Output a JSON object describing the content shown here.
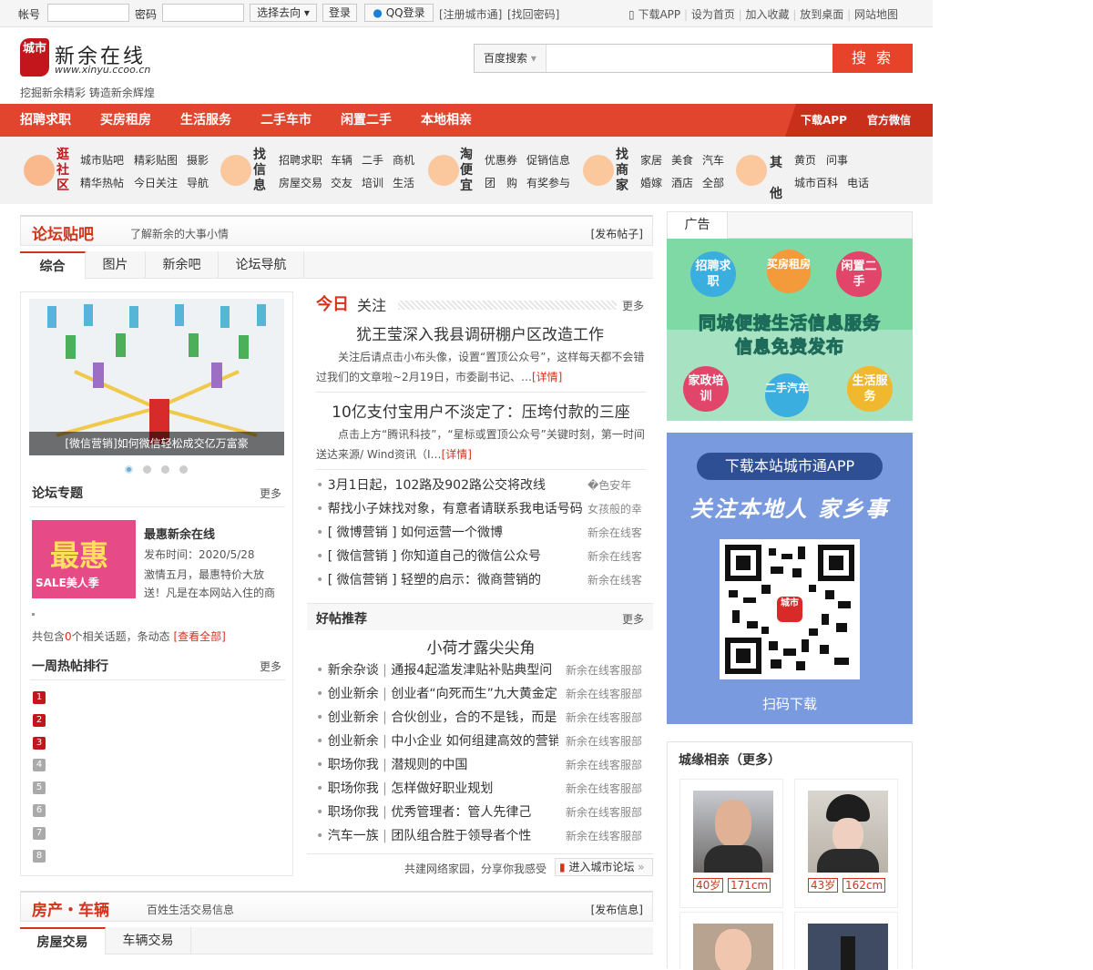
{
  "topbar": {
    "account_label": "帐号",
    "password_label": "密码",
    "destination": "选择去向",
    "login": "登录",
    "qq_login": "QQ登录",
    "register": "[注册城市通]",
    "recover": "[找回密码]",
    "links": [
      "下载APP",
      "设为首页",
      "加入收藏",
      "放到桌面",
      "网站地图"
    ]
  },
  "header": {
    "logo_badge": "城市",
    "site_name": "新余在线",
    "site_url": "www.xinyu.ccoo.cn",
    "slogan": "挖掘新余精彩 铸造新余辉煌",
    "search_engine": "百度搜索",
    "search_button": "搜 索",
    "search_placeholder": ""
  },
  "nav": {
    "items": [
      "招聘求职",
      "买房租房",
      "生活服务",
      "二手车市",
      "闲置二手",
      "本地相亲"
    ],
    "right": [
      "下载APP",
      "官方微信"
    ]
  },
  "categories": [
    {
      "title": "逛社区",
      "links": [
        "城市贴吧",
        "精彩贴图",
        "摄影",
        "精华热帖",
        "今日关注",
        "导航"
      ]
    },
    {
      "title": "找信息",
      "links": [
        "招聘求职",
        "车辆",
        "二手",
        "商机",
        "房屋交易",
        "交友",
        "培训",
        "生活"
      ]
    },
    {
      "title": "淘便宜",
      "links": [
        "优惠券",
        "促销信息",
        "团",
        "购",
        "有奖参与"
      ]
    },
    {
      "title": "找商家",
      "links": [
        "家居",
        "美食",
        "汽车",
        "婚嫁",
        "酒店",
        "全部"
      ]
    },
    {
      "title": "其他",
      "links": [
        "黄页",
        "问事",
        "城市百科",
        "电话"
      ]
    }
  ],
  "forum": {
    "title": "论坛贴吧",
    "subtitle": "了解新余的大事小情",
    "action": "[发布帖子]",
    "tabs": [
      "综合",
      "图片",
      "新余吧",
      "论坛导航"
    ],
    "slide_caption": "[微信营销]如何微信轻松成交亿万富豪",
    "topic_title": "论坛专题",
    "more": "更多",
    "topic_name": "最惠新余在线",
    "topic_date": "发布时间：2020/5/28",
    "topic_desc": "激情五月，最惠特价大放送！凡是在本网站入住的商",
    "topic_summary_pre": "共包含",
    "topic_summary_count": "0",
    "topic_summary_post": "个相关话题，条动态",
    "view_all": "[查看全部]",
    "weekly_title": "一周热帖排行",
    "ranks": [
      "1",
      "2",
      "3",
      "4",
      "5",
      "6",
      "7",
      "8"
    ],
    "promo_big": "最惠",
    "promo_small": "SALE美人季",
    "today_red": "今日",
    "today_black": "关注",
    "articles": [
      {
        "title": "犹王莹深入我县调研棚户区改造工作",
        "summary": "关注后请点击小布头像，设置“置顶公众号”，这样每天都不会错过我们的文章啦~2月19日，市委副书记、…",
        "detail": "[详情]"
      },
      {
        "title": "10亿支付宝用户不淡定了：压垮付款的三座",
        "summary": "点击上方“腾讯科技”，“星标或置顶公众号”关键时刻，第一时间送达来源/ Wind资讯（I…",
        "detail": "[详情]"
      }
    ],
    "news": [
      {
        "t": "3月1日起，102路及902路公交将改线",
        "s": "�色安年"
      },
      {
        "t": "帮找小子妹找对象，有意者请联系我电话号码",
        "s": "女孩般的幸"
      },
      {
        "t": "[ 微博营销 ] 如何运营一个微博",
        "s": "新余在线客"
      },
      {
        "t": "[ 微信营销 ] 你知道自己的微信公众号",
        "s": "新余在线客"
      },
      {
        "t": "[ 微信营销 ] 轻塑的启示：微商营销的",
        "s": "新余在线客"
      }
    ],
    "rec_title": "好帖推荐",
    "rec_headline": "小荷才露尖尖角",
    "rec": [
      {
        "c": "新余杂谈",
        "t": "通报4起滥发津贴补贴典型问",
        "s": "新余在线客服部"
      },
      {
        "c": "创业新余",
        "t": "创业者“向死而生”九大黄金定",
        "s": "新余在线客服部"
      },
      {
        "c": "创业新余",
        "t": "合伙创业，合的不是钱，而是",
        "s": "新余在线客服部"
      },
      {
        "c": "创业新余",
        "t": "中小企业 如何组建高效的营销",
        "s": "新余在线客服部"
      },
      {
        "c": "职场你我",
        "t": "潜规则的中国",
        "s": "新余在线客服部"
      },
      {
        "c": "职场你我",
        "t": "怎样做好职业规划",
        "s": "新余在线客服部"
      },
      {
        "c": "职场你我",
        "t": "优秀管理者：管人先律己",
        "s": "新余在线客服部"
      },
      {
        "c": "汽车一族",
        "t": "团队组合胜于领导者个性",
        "s": "新余在线客服部"
      }
    ],
    "footer_note": "共建网络家园，分享你我感受",
    "enter_forum": "进入城市论坛"
  },
  "ad": {
    "title": "广告",
    "bubbles": [
      "招聘求职",
      "买房租房",
      "闲置二手",
      "家政培训",
      "二手汽车",
      "生活服务"
    ],
    "headline1": "同城便捷生活信息服务",
    "headline2": "信息免费发布",
    "app_title": "下载本站城市通APP",
    "app_slogan": "关注本地人 家乡事",
    "qr_badge": "城市",
    "scan": "扫码下载"
  },
  "dating": {
    "title": "城缘相亲（更多）",
    "people": [
      {
        "age": "40岁",
        "height": "171cm"
      },
      {
        "age": "43岁",
        "height": "162cm"
      }
    ]
  },
  "property": {
    "title": "房产・车辆",
    "subtitle": "百姓生活交易信息",
    "action": "[发布信息]",
    "tabs": [
      "房屋交易",
      "车辆交易"
    ]
  },
  "colors": {
    "brand_red": "#e2452e",
    "title_red": "#d6311b",
    "ad_green": "#7fd9a5",
    "app_blue": "#6e8fd9"
  }
}
